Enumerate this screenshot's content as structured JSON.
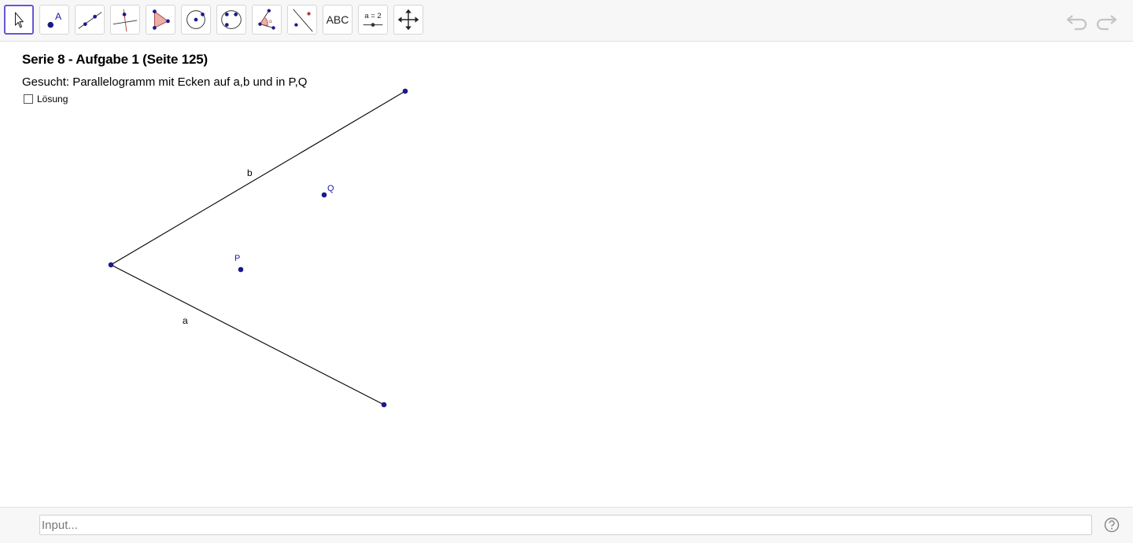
{
  "toolbar": {
    "tools": [
      {
        "name": "move-tool"
      },
      {
        "name": "point-tool"
      },
      {
        "name": "line-tool"
      },
      {
        "name": "perpendicular-line-tool"
      },
      {
        "name": "polygon-tool"
      },
      {
        "name": "circle-center-point-tool"
      },
      {
        "name": "conic-tool"
      },
      {
        "name": "angle-tool"
      },
      {
        "name": "reflect-tool"
      },
      {
        "name": "text-tool",
        "label": "ABC"
      },
      {
        "name": "slider-tool",
        "label": "a = 2"
      },
      {
        "name": "move-graphics-view-tool"
      }
    ],
    "undo_icon": "undo-icon",
    "redo_icon": "redo-icon"
  },
  "canvas": {
    "title": "Serie 8 - Aufgabe 1 (Seite 125)",
    "subtitle": "Gesucht: Parallelogramm mit Ecken auf a,b und in P,Q",
    "checkbox_label": "Lösung",
    "checkbox_checked": false,
    "labels": {
      "line_a": "a",
      "line_b": "b",
      "point_p": "P",
      "point_q": "Q"
    },
    "colors": {
      "point": "#1a1a8c",
      "line": "#000000",
      "point_label": "#1a1aa6",
      "active_tool": "#6557d2"
    }
  },
  "bottom": {
    "input_placeholder": "Input...",
    "help_icon": "help-icon"
  }
}
